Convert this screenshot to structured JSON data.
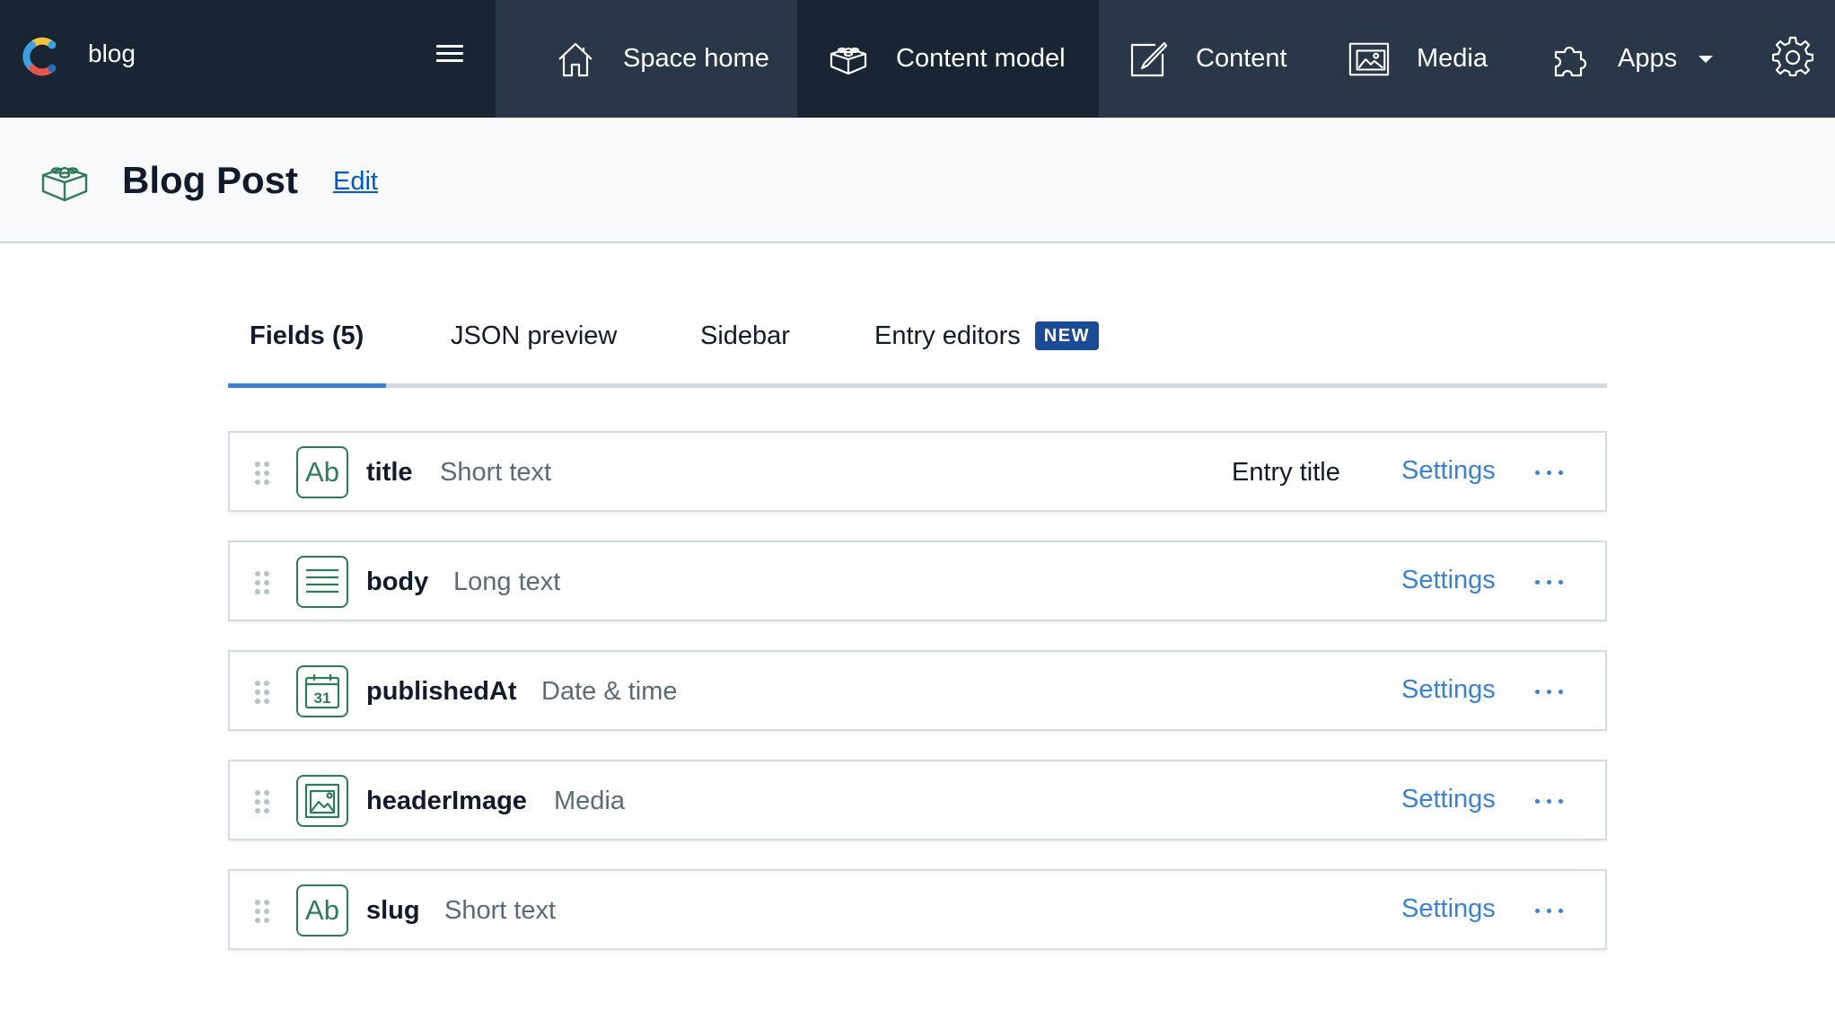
{
  "topnav": {
    "space_name": "blog",
    "items": [
      {
        "label": "Space home",
        "icon": "home-icon"
      },
      {
        "label": "Content model",
        "icon": "cube-icon",
        "active": true
      },
      {
        "label": "Content",
        "icon": "edit-icon"
      },
      {
        "label": "Media",
        "icon": "image-icon"
      },
      {
        "label": "Apps",
        "icon": "puzzle-icon"
      }
    ],
    "settings_icon": "gear-icon",
    "menu_icon": "hamburger-icon",
    "colors": {
      "nav_bg": "#2a3748",
      "nav_dark": "#192532"
    }
  },
  "header": {
    "title": "Blog Post",
    "edit_label": "Edit"
  },
  "tabs": [
    {
      "label": "Fields (5)",
      "active": true
    },
    {
      "label": "JSON preview"
    },
    {
      "label": "Sidebar"
    },
    {
      "label": "Entry editors",
      "badge": "NEW"
    }
  ],
  "fields": [
    {
      "name": "title",
      "type": "Short text",
      "icon": "short-text-icon",
      "entry_title": "Entry title",
      "settings_label": "Settings"
    },
    {
      "name": "body",
      "type": "Long text",
      "icon": "long-text-icon",
      "settings_label": "Settings"
    },
    {
      "name": "publishedAt",
      "type": "Date & time",
      "icon": "calendar-icon",
      "icon_text": "31",
      "settings_label": "Settings"
    },
    {
      "name": "headerImage",
      "type": "Media",
      "icon": "media-icon",
      "settings_label": "Settings"
    },
    {
      "name": "slug",
      "type": "Short text",
      "icon": "short-text-icon",
      "settings_label": "Settings"
    }
  ],
  "icon_text": {
    "short_text": "Ab"
  },
  "colors": {
    "accent": "#3c80cf",
    "field_icon": "#2f7b59",
    "badge": "#1c4b96",
    "link": "#0059c8"
  }
}
